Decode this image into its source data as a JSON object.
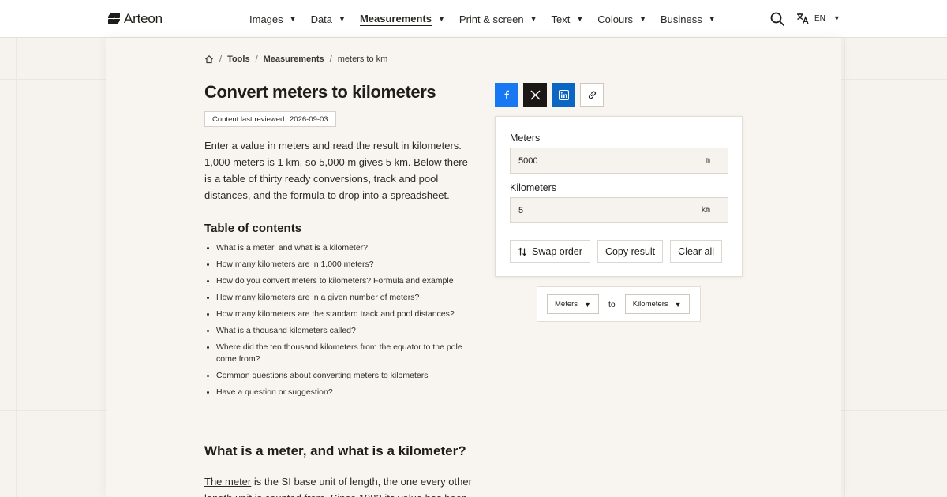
{
  "brand": {
    "name": "Arteon"
  },
  "nav": {
    "items": [
      {
        "label": "Images"
      },
      {
        "label": "Data"
      },
      {
        "label": "Measurements",
        "active": true
      },
      {
        "label": "Print & screen"
      },
      {
        "label": "Text"
      },
      {
        "label": "Colours"
      },
      {
        "label": "Business"
      }
    ],
    "language": "EN"
  },
  "breadcrumb": {
    "items": [
      "Tools",
      "Measurements"
    ],
    "current": "meters to km"
  },
  "page": {
    "title": "Convert meters to kilometers",
    "reviewed_label": "Content last reviewed:",
    "reviewed_date": "2026-09-03",
    "intro": "Enter a value in meters and read the result in kilometers. 1,000 meters is 1 km, so 5,000 m gives 5 km. Below there is a table of thirty ready conversions, track and pool distances, and the formula to drop into a spreadsheet."
  },
  "toc": {
    "title": "Table of contents",
    "items": [
      "What is a meter, and what is a kilometer?",
      "How many kilometers are in 1,000 meters?",
      "How do you convert meters to kilometers? Formula and example",
      "How many kilometers are in a given number of meters?",
      "How many kilometers are the standard track and pool distances?",
      "What is a thousand kilometers called?",
      "Where did the ten thousand kilometers from the equator to the pole come from?",
      "Common questions about converting meters to kilometers",
      "Have a question or suggestion?"
    ]
  },
  "section": {
    "title": "What is a meter, and what is a kilometer?",
    "link_text": "The meter",
    "body_start": " is the SI base unit of length, the one every other length unit is counted from. Since 1983 its value has been"
  },
  "converter": {
    "from_label": "Meters",
    "from_value": "5000",
    "from_unit": "m",
    "to_label": "Kilometers",
    "to_value": "5",
    "to_unit": "km",
    "swap_label": "Swap order",
    "copy_label": "Copy result",
    "clear_label": "Clear all"
  },
  "unit_picker": {
    "from": "Meters",
    "to_word": "to",
    "to": "Kilometers"
  },
  "colors": {
    "facebook": "#1877f2",
    "x": "#1a1714",
    "linkedin": "#0a66c2"
  }
}
